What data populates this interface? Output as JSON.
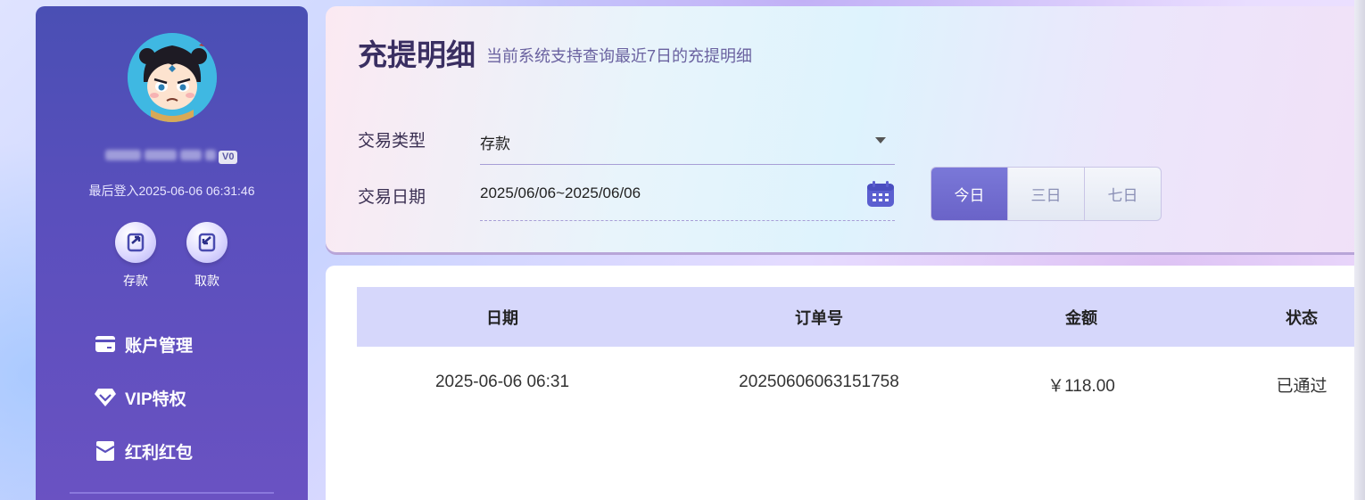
{
  "sidebar": {
    "level_badge": "V0",
    "last_login": "最后登入2025-06-06 06:31:46",
    "quick_actions": [
      {
        "label": "存款",
        "icon": "deposit-icon"
      },
      {
        "label": "取款",
        "icon": "withdraw-icon"
      }
    ],
    "menu": [
      {
        "label": "账户管理",
        "icon": "card-icon"
      },
      {
        "label": "VIP特权",
        "icon": "diamond-icon"
      },
      {
        "label": "红利红包",
        "icon": "envelope-icon"
      }
    ]
  },
  "header": {
    "title": "充提明细",
    "subtitle": "当前系统支持查询最近7日的充提明细"
  },
  "filters": {
    "type_label": "交易类型",
    "type_value": "存款",
    "date_label": "交易日期",
    "date_value": "2025/06/06~2025/06/06",
    "ranges": [
      "今日",
      "三日",
      "七日"
    ],
    "active_range": "今日"
  },
  "table": {
    "columns": [
      "日期",
      "订单号",
      "金额",
      "状态"
    ],
    "rows": [
      [
        "2025-06-06 06:31",
        "20250606063151758",
        "￥118.00",
        "已通过"
      ]
    ]
  },
  "colors": {
    "sidebar": "#5a4fbc",
    "accent": "#6a63c8",
    "table_header": "#d6d7fb"
  }
}
